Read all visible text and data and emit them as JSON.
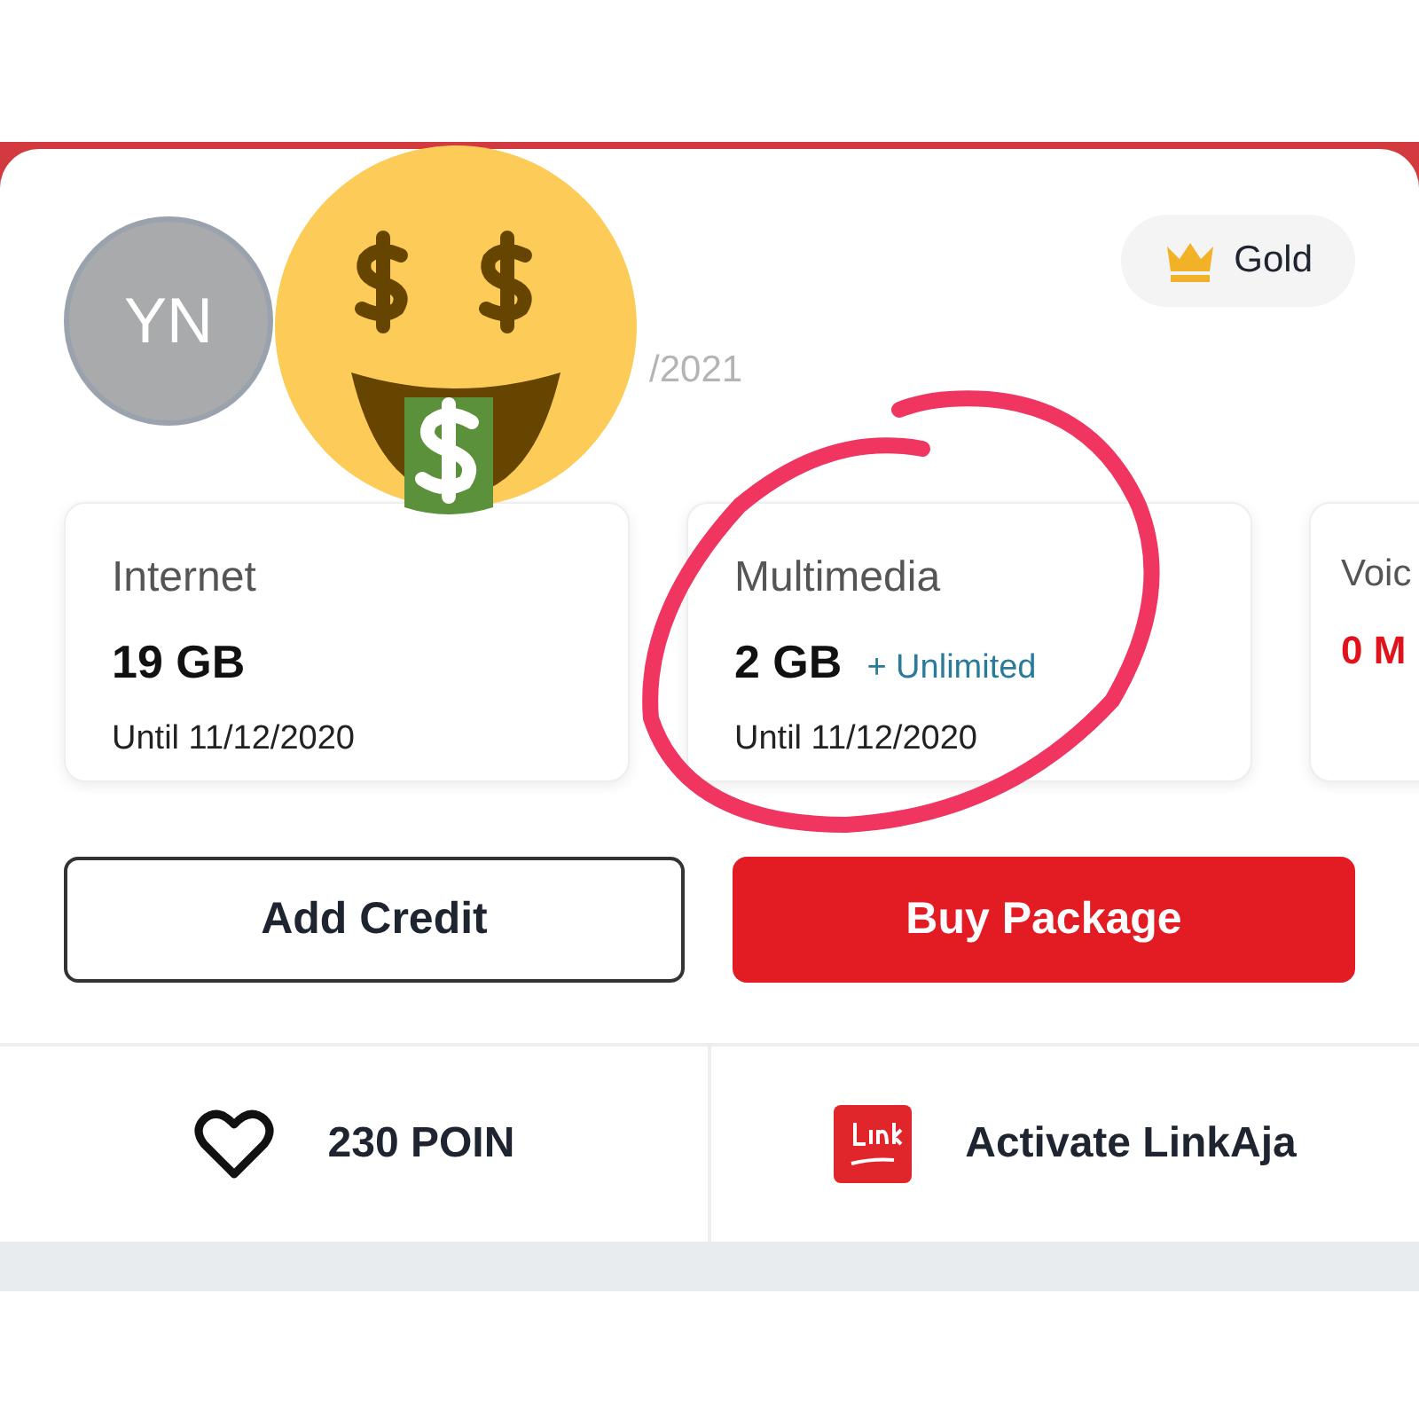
{
  "profile": {
    "initials": "YN",
    "date_fragment": "/2021",
    "tier": "Gold"
  },
  "quota_cards": [
    {
      "title": "Internet",
      "amount": "19 GB",
      "until": "Until 11/12/2020",
      "empty": false
    },
    {
      "title": "Multimedia",
      "amount": "2 GB",
      "extra": "+ Unlimited",
      "until": "Until 11/12/2020",
      "empty": false
    },
    {
      "title": "Voic",
      "amount": "0 M",
      "empty": true
    }
  ],
  "buttons": [
    {
      "label": "Add Credit",
      "kind": "outline"
    },
    {
      "label": "Buy Package",
      "kind": "primary"
    }
  ],
  "shortcuts": [
    {
      "label": "230 POIN",
      "kind": "points"
    },
    {
      "label": "Activate LinkAja",
      "kind": "wallet"
    }
  ]
}
